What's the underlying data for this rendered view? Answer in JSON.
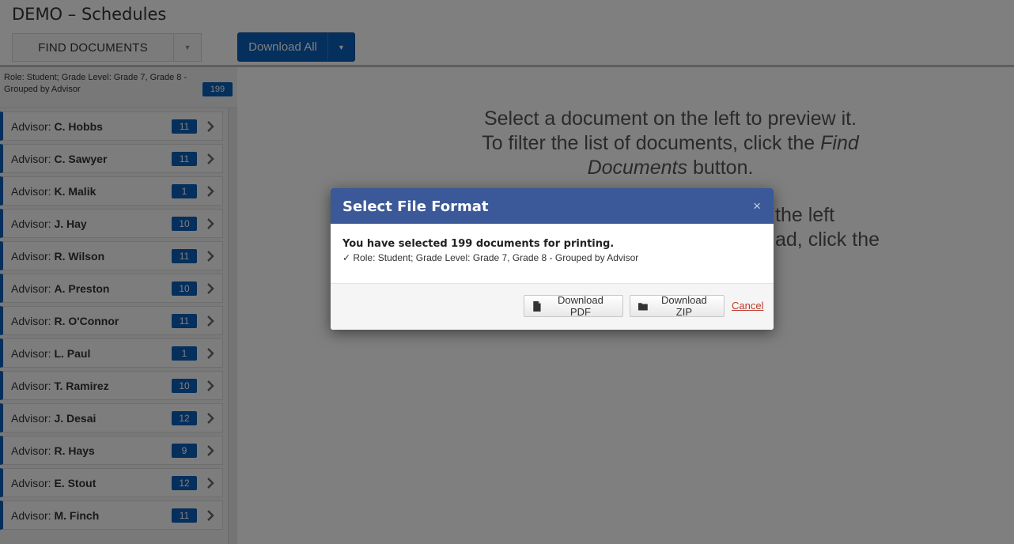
{
  "app": {
    "title": "DEMO – Schedules"
  },
  "toolbar": {
    "find_label": "FIND DOCUMENTS",
    "download_all_label": "Download All"
  },
  "sidebar": {
    "summary": "Role: Student; Grade Level: Grade 7, Grade 8 - Grouped by Advisor",
    "summary_count": "199",
    "items": [
      {
        "prefix": "Advisor: ",
        "name": "C. Hobbs",
        "count": "11"
      },
      {
        "prefix": "Advisor: ",
        "name": "C. Sawyer",
        "count": "11"
      },
      {
        "prefix": "Advisor: ",
        "name": "K. Malik",
        "count": "1"
      },
      {
        "prefix": "Advisor: ",
        "name": "J. Hay",
        "count": "10"
      },
      {
        "prefix": "Advisor: ",
        "name": "R. Wilson",
        "count": "11"
      },
      {
        "prefix": "Advisor: ",
        "name": "A. Preston",
        "count": "10"
      },
      {
        "prefix": "Advisor: ",
        "name": "R. O'Connor",
        "count": "11"
      },
      {
        "prefix": "Advisor: ",
        "name": "L. Paul",
        "count": "1"
      },
      {
        "prefix": "Advisor: ",
        "name": "T. Ramirez",
        "count": "10"
      },
      {
        "prefix": "Advisor: ",
        "name": "J. Desai",
        "count": "12"
      },
      {
        "prefix": "Advisor: ",
        "name": "R. Hays",
        "count": "9"
      },
      {
        "prefix": "Advisor: ",
        "name": "E. Stout",
        "count": "12"
      },
      {
        "prefix": "Advisor: ",
        "name": "M. Finch",
        "count": "11"
      }
    ]
  },
  "preview": {
    "line1": "Select a document on the left to preview it.",
    "line2_a": "To filter the list of documents, click the ",
    "line2_em": "Find Documents",
    "line2_b": " button.",
    "line3_visible_tail": "the left",
    "line4_visible_tail": "ad, click the"
  },
  "modal": {
    "title": "Select File Format",
    "close": "×",
    "lead": "You have selected 199 documents for printing.",
    "detail": "✓ Role: Student; Grade Level: Grade 7, Grade 8 - Grouped by Advisor",
    "download_pdf": "Download PDF",
    "download_zip": "Download ZIP",
    "cancel": "Cancel"
  },
  "colors": {
    "accent": "#0b5fb8",
    "modal_header": "#3b5998",
    "cancel_link": "#c0392b"
  }
}
